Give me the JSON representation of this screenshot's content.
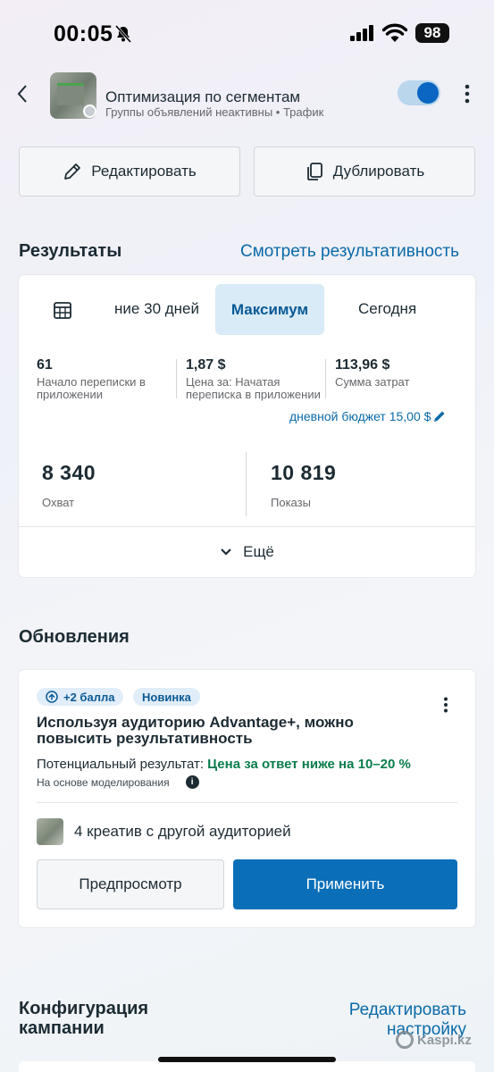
{
  "status": {
    "time": "00:05",
    "battery": "98"
  },
  "header": {
    "title": "Оптимизация по сегментам",
    "subtitle": "Группы объявлений неактивны • Трафик"
  },
  "actions": {
    "edit_label": "Редактировать",
    "duplicate_label": "Дублировать"
  },
  "results": {
    "title": "Результаты",
    "link": "Смотреть результативность",
    "tabs": [
      "ние 30 дней",
      "Максимум",
      "Сегодня"
    ],
    "active_tab": "Максимум",
    "metrics": [
      {
        "value": "61",
        "label": "Начало переписки в приложении"
      },
      {
        "value": "1,87 $",
        "label": "Цена за: Начатая переписка в приложении"
      },
      {
        "value": "113,96 $",
        "label": "Сумма затрат"
      }
    ],
    "budget": "дневной бюджет 15,00 $",
    "reach": {
      "value": "8 340",
      "label": "Охват"
    },
    "impressions": {
      "value": "10 819",
      "label": "Показы"
    },
    "more": "Ещё"
  },
  "updates": {
    "title": "Обновления",
    "badge_points": "+2 балла",
    "badge_new": "Новинка",
    "headline": "Используя аудиторию Advantage+, можно повысить результативность",
    "potential_label": "Потенциальный результат:",
    "potential_value": "Цена за ответ ниже на 10–20 %",
    "based_on": "На основе моделирования",
    "creatives": "4 креатив с другой аудиторией",
    "preview": "Предпросмотр",
    "apply": "Применить"
  },
  "config": {
    "title": "Конфигурация кампании",
    "link": "Редактировать настройку"
  },
  "watermark": "Kaspi.kz",
  "colors": {
    "accent": "#0a6eb8",
    "link": "#0a6aa8",
    "green": "#0a7d4d",
    "active_tab_bg": "#d9ebf7"
  }
}
